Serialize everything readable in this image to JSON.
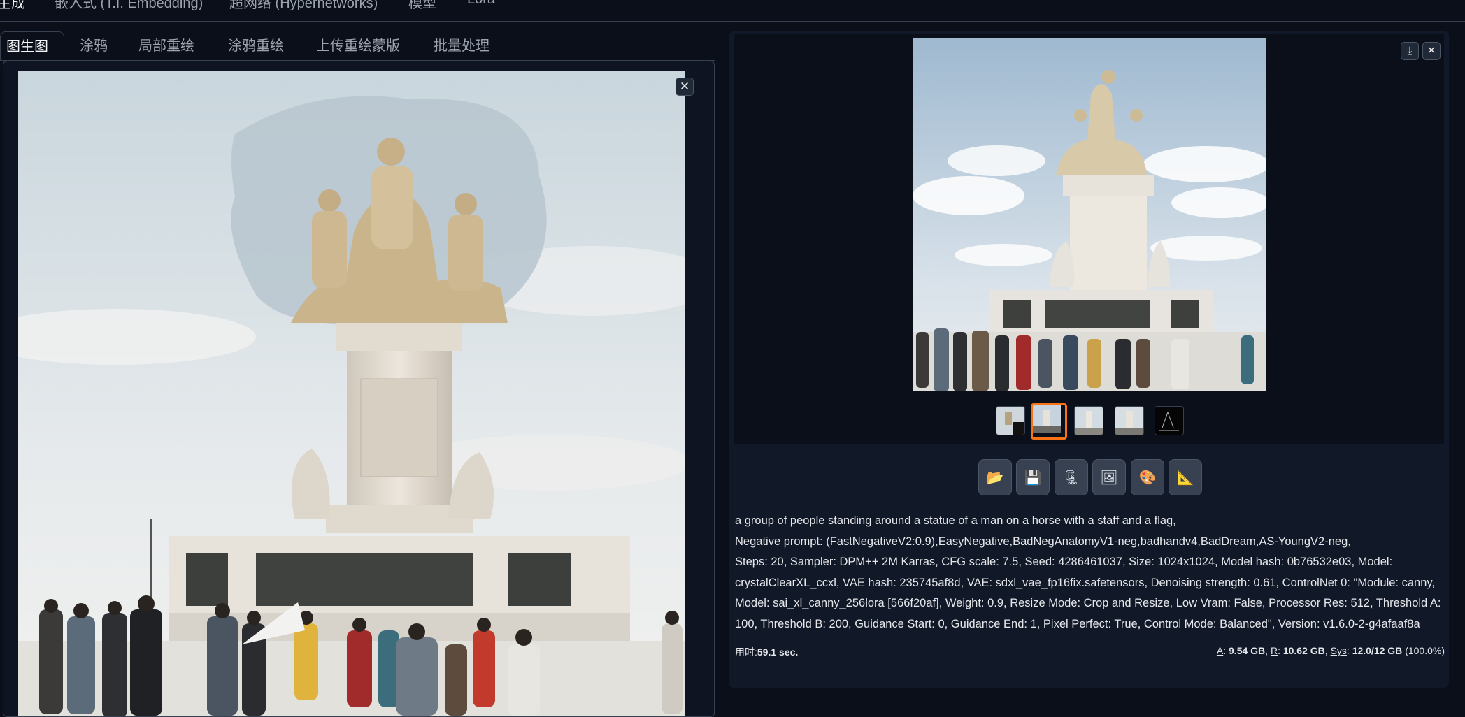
{
  "top_tabs": [
    {
      "label": "生成"
    },
    {
      "label": "嵌入式 (T.I. Embedding)"
    },
    {
      "label": "超网络 (Hypernetworks)"
    },
    {
      "label": "模型"
    },
    {
      "label": "Lora"
    }
  ],
  "sub_tabs": [
    {
      "label": "图生图"
    },
    {
      "label": "涂鸦"
    },
    {
      "label": "局部重绘"
    },
    {
      "label": "涂鸦重绘"
    },
    {
      "label": "上传重绘蒙版"
    },
    {
      "label": "批量处理"
    }
  ],
  "canvas": {
    "close_icon": "close-icon",
    "close_glyph": "✕"
  },
  "gallery": {
    "download_glyph": "⤓",
    "close_glyph": "✕",
    "thumbnails": 5,
    "selected_thumbnail": 2
  },
  "toolbar": [
    {
      "icon": "folder-icon",
      "glyph": "📂"
    },
    {
      "icon": "save-icon",
      "glyph": "💾"
    },
    {
      "icon": "zip-icon",
      "glyph": "🗜"
    },
    {
      "icon": "send-to-img2img-icon",
      "glyph": "🖼"
    },
    {
      "icon": "palette-icon",
      "glyph": "🎨"
    },
    {
      "icon": "ruler-icon",
      "glyph": "📐"
    }
  ],
  "info": {
    "prompt": "a group of people standing around a statue of a man on a horse with a staff and a flag,",
    "negative": "Negative prompt: (FastNegativeV2:0.9),EasyNegative,BadNegAnatomyV1-neg,badhandv4,BadDream,AS-YoungV2-neg,",
    "params1": "Steps: 20, Sampler: DPM++ 2M Karras, CFG scale: 7.5, Seed: 4286461037, Size: 1024x1024, Model hash: 0b76532e03, Model:",
    "params2": "crystalClearXL_ccxl, VAE hash: 235745af8d, VAE: sdxl_vae_fp16fix.safetensors, Denoising strength: 0.61, ControlNet 0: \"Module: canny,",
    "params3": "Model: sai_xl_canny_256lora [566f20af], Weight: 0.9, Resize Mode: Crop and Resize, Low Vram: False, Processor Res: 512, Threshold A:",
    "params4": "100, Threshold B: 200, Guidance Start: 0, Guidance End: 1, Pixel Perfect: True, Control Mode: Balanced\", Version: v1.6.0-2-g4afaaf8a"
  },
  "timing": {
    "label": "用时:",
    "value": "59.1 sec."
  },
  "memory": {
    "a_label": "A",
    "a_value": "9.54 GB",
    "r_label": "R",
    "r_value": "10.62 GB",
    "sys_label": "Sys",
    "sys_value": "12.0/12 GB",
    "pct": "(100.0%)"
  },
  "colors": {
    "accent": "#f97316",
    "bg": "#0b0f19",
    "panel": "#111827"
  }
}
